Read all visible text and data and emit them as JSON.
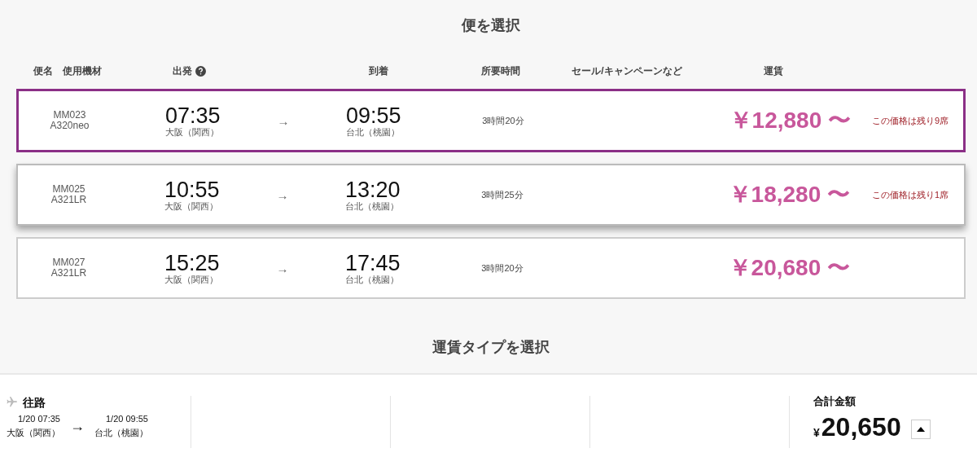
{
  "title": "便を選択",
  "columns": [
    {
      "kind": "flight",
      "labels": [
        "便名",
        "使用機材"
      ]
    },
    {
      "kind": "departure",
      "labels": [
        "出発"
      ],
      "help_icon": true
    },
    {
      "kind": "arrow"
    },
    {
      "kind": "arrival",
      "labels": [
        "到着"
      ]
    },
    {
      "kind": "duration",
      "labels": [
        "所要時間"
      ]
    },
    {
      "kind": "sale",
      "labels": [
        "セール/キャンペーンなど"
      ]
    },
    {
      "kind": "fare",
      "labels": [
        "運賃"
      ]
    },
    {
      "kind": "remaining"
    }
  ],
  "flights": [
    {
      "number": "MM023",
      "aircraft": "A320neo",
      "dep_time": "07:35",
      "dep_airport": "大阪（関西）",
      "arrow": "→",
      "arr_time": "09:55",
      "arr_airport": "台北（桃園）",
      "duration": "3時間20分",
      "fare": "￥12,880 〜",
      "remaining": "この価格は残り9席",
      "selected": true,
      "hovered": false
    },
    {
      "number": "MM025",
      "aircraft": "A321LR",
      "dep_time": "10:55",
      "dep_airport": "大阪（関西）",
      "arrow": "→",
      "arr_time": "13:20",
      "arr_airport": "台北（桃園）",
      "duration": "3時間25分",
      "fare": "￥18,280 〜",
      "remaining": "この価格は残り1席",
      "selected": false,
      "hovered": true
    },
    {
      "number": "MM027",
      "aircraft": "A321LR",
      "dep_time": "15:25",
      "dep_airport": "大阪（関西）",
      "arrow": "→",
      "arr_time": "17:45",
      "arr_airport": "台北（桃園）",
      "duration": "3時間20分",
      "fare": "￥20,680 〜",
      "selected": false,
      "hovered": false
    }
  ],
  "fare_type_title": "運賃タイプを選択",
  "summary": {
    "leg_label": "往路",
    "dep_datetime": "1/20 07:35",
    "dep_airport": "大阪（関西）",
    "arrow": "→",
    "arr_datetime": "1/20 09:55",
    "arr_airport": "台北（桃園）",
    "total_label": "合計金額",
    "currency": "¥",
    "total": "20,650",
    "expanded": false
  }
}
